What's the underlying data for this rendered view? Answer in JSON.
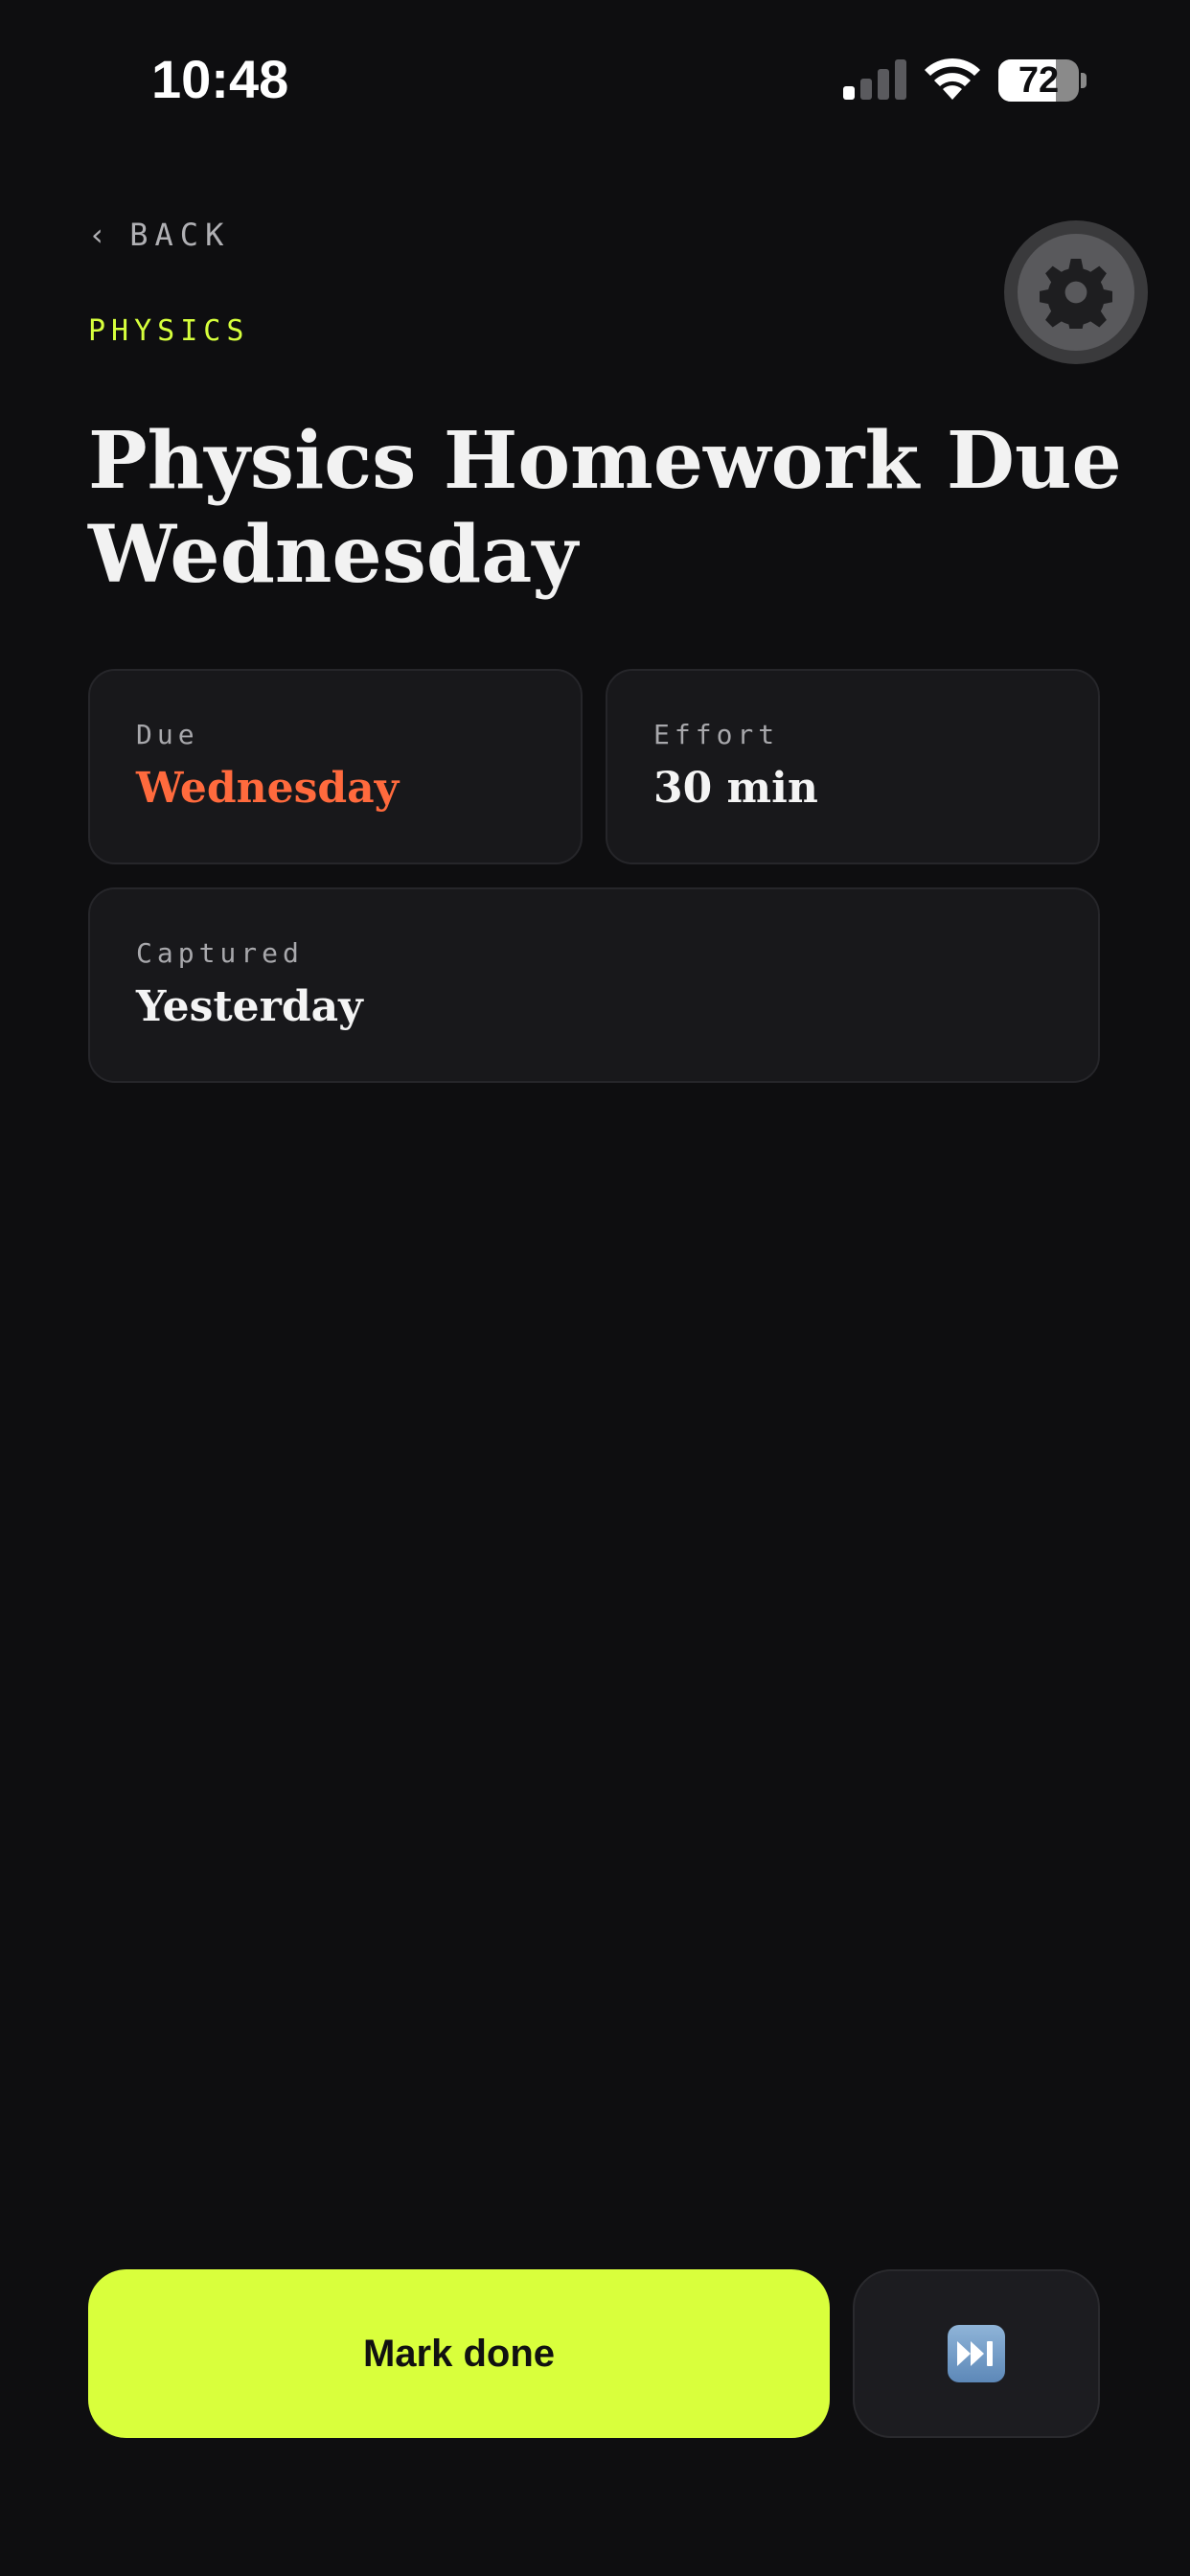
{
  "status_bar": {
    "time": "10:48",
    "battery_level": "72",
    "battery_fraction": 0.72
  },
  "nav": {
    "back_label": "BACK",
    "back_chevron": "‹"
  },
  "task": {
    "category": "PHYSICS",
    "title": "Physics Homework Due Wednesday"
  },
  "details": {
    "due": {
      "label": "Due",
      "value": "Wednesday"
    },
    "effort": {
      "label": "Effort",
      "value": "30 min"
    },
    "captured": {
      "label": "Captured",
      "value": "Yesterday"
    }
  },
  "actions": {
    "mark_done_label": "Mark done",
    "skip_icon": "fast-forward-icon"
  },
  "colors": {
    "background": "#0e0e10",
    "accent_lime": "#d9ff3c",
    "due_accent": "#ff6a3d",
    "card_bg": "#18181b"
  },
  "icons": {
    "settings": "gear-icon",
    "signal": "cellular-signal-icon",
    "wifi": "wifi-icon",
    "battery": "battery-icon"
  }
}
